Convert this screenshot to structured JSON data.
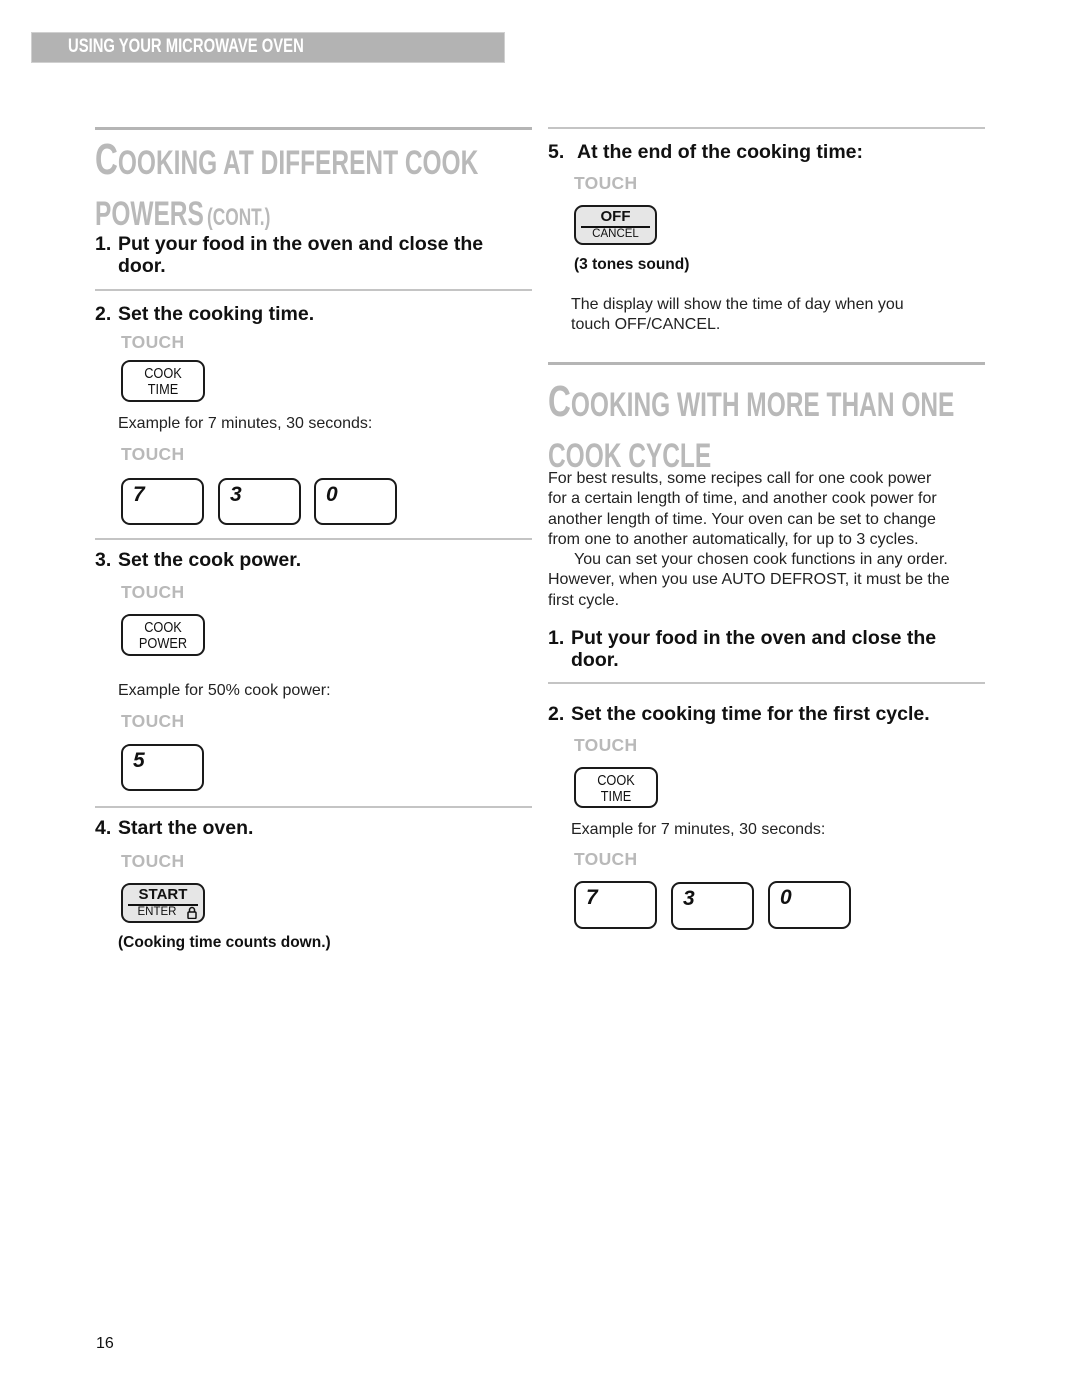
{
  "header": {
    "section": "USING YOUR MICROWAVE OVEN"
  },
  "left": {
    "title": {
      "line1_cap": "C",
      "line1_rest": "OOKING AT DIFFERENT COOK",
      "line2": "POWERS",
      "line2_suffix": "(CONT.)"
    },
    "steps": [
      {
        "num": "1.",
        "text_line1": "Put your food in the oven and close the",
        "text_line2": "door."
      },
      {
        "num": "2.",
        "text": "Set the cooking time.",
        "touch1": "TOUCH",
        "key": {
          "line1": "COOK",
          "line2": "TIME"
        },
        "example": "Example for 7 minutes, 30 seconds:",
        "touch2": "TOUCH",
        "digits": [
          "7",
          "3",
          "0"
        ]
      },
      {
        "num": "3.",
        "text": "Set the cook power.",
        "touch1": "TOUCH",
        "key": {
          "line1": "COOK",
          "line2": "POWER"
        },
        "example": "Example for 50% cook power:",
        "touch2": "TOUCH",
        "digits": [
          "5"
        ]
      },
      {
        "num": "4.",
        "text": "Start the oven.",
        "touch1": "TOUCH",
        "key": {
          "top": "START",
          "bottom": "ENTER"
        },
        "note": "(Cooking time counts down.)"
      }
    ]
  },
  "right": {
    "step5": {
      "num": "5.",
      "text": "At the end of the cooking time:",
      "touch": "TOUCH",
      "key": {
        "top": "OFF",
        "bottom": "CANCEL"
      },
      "note": "(3 tones sound)",
      "body_line1": "The display will show the time of day when you",
      "body_line2": "touch OFF/CANCEL."
    },
    "title": {
      "line1_cap": "C",
      "line1_rest": "OOKING WITH MORE THAN ONE",
      "line2": "COOK CYCLE"
    },
    "intro": [
      "For best results, some recipes call for one cook power",
      "for a certain length of time, and another cook power for",
      "another length of time. Your oven can be set to change",
      "from one to another automatically, for up to 3 cycles.",
      "You can set your chosen cook functions in any order.",
      "However, when you use AUTO DEFROST, it must be the",
      "first cycle."
    ],
    "steps": [
      {
        "num": "1.",
        "text_line1": "Put your food in the oven and close the",
        "text_line2": "door."
      },
      {
        "num": "2.",
        "text": "Set the cooking time for the first cycle.",
        "touch1": "TOUCH",
        "key": {
          "line1": "COOK",
          "line2": "TIME"
        },
        "example": "Example for 7 minutes, 30 seconds:",
        "touch2": "TOUCH",
        "digits": [
          "7",
          "3",
          "0"
        ]
      }
    ]
  },
  "footer": {
    "page_number": "16"
  }
}
